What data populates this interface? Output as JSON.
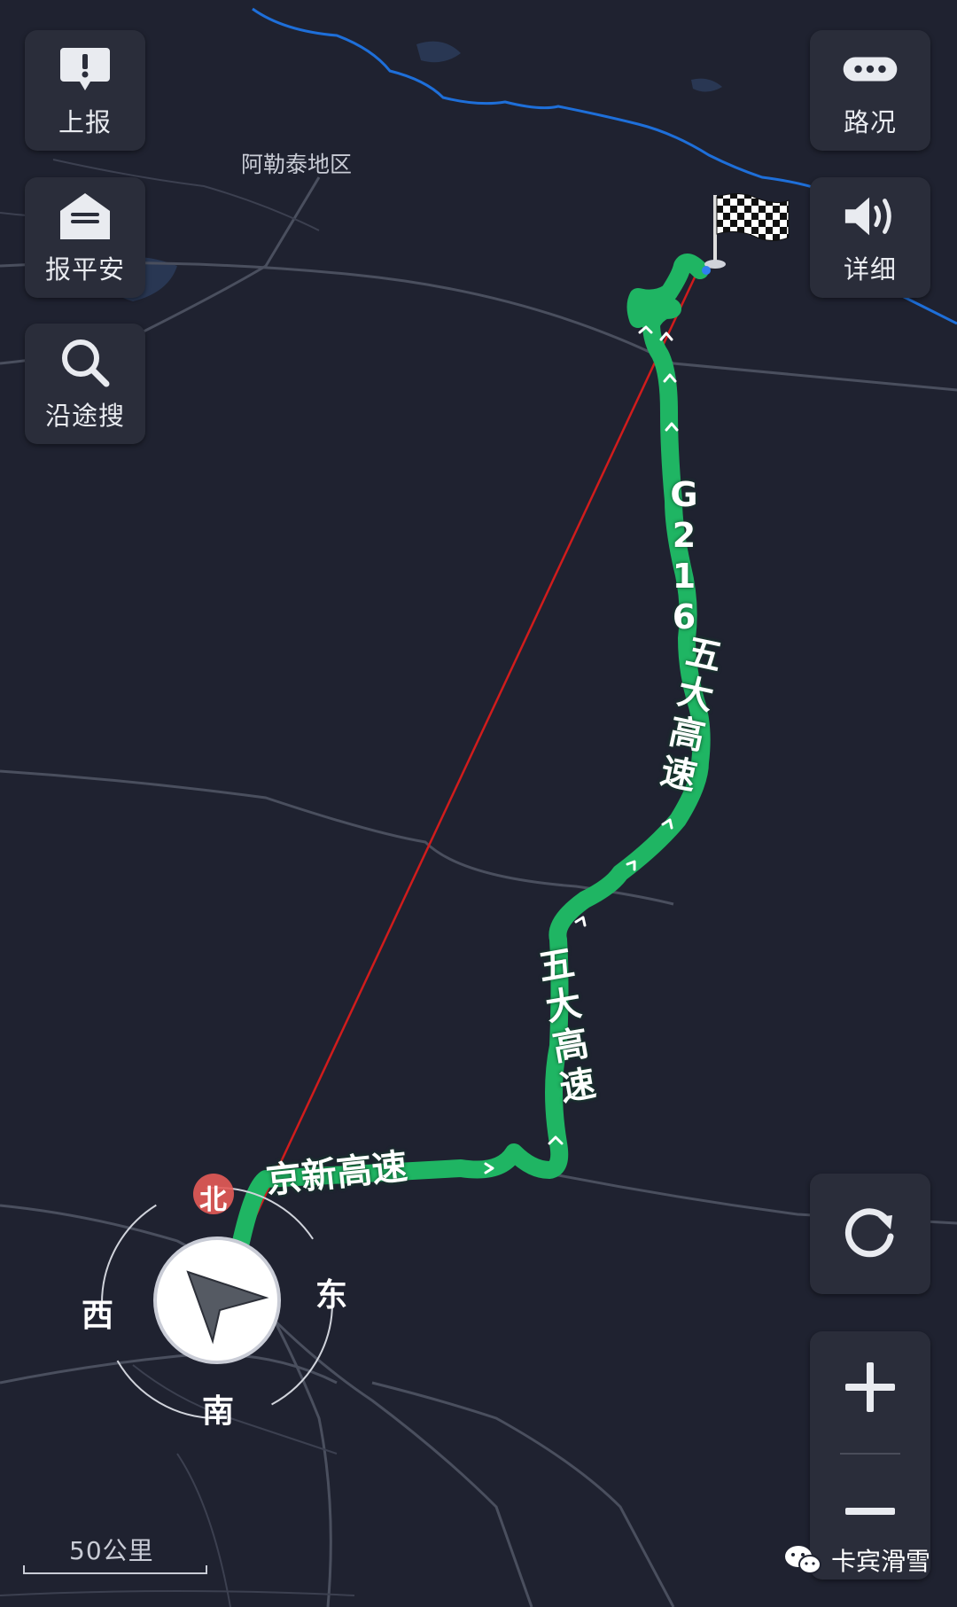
{
  "buttons": {
    "report": "上报",
    "safe": "报平安",
    "search": "沿途搜",
    "traffic": "路况",
    "detail": "详细"
  },
  "map": {
    "region": "阿勒泰地区",
    "roads": {
      "g216": "G216",
      "wuda_upper": "五大高速",
      "wuda_lower": "五大高速",
      "jingxin": "京新高速"
    },
    "compass": {
      "north": "北",
      "south": "南",
      "east": "东",
      "west": "西"
    },
    "scale": "50公里"
  },
  "watermark": "卡宾滑雪",
  "icons": {
    "report": "alert-icon",
    "safe": "envelope-icon",
    "search": "search-icon",
    "traffic": "more-dots-icon",
    "detail": "speaker-icon",
    "refresh": "refresh-icon",
    "zoom_in": "plus-icon",
    "zoom_out": "minus-icon",
    "destination": "checkered-flag-icon",
    "position": "navigation-arrow-icon"
  },
  "colors": {
    "background": "#1f2230",
    "route": "#1fb563",
    "river": "#1e6fd9",
    "direct_line": "#d01c1c",
    "north_badge": "#e45b58"
  }
}
